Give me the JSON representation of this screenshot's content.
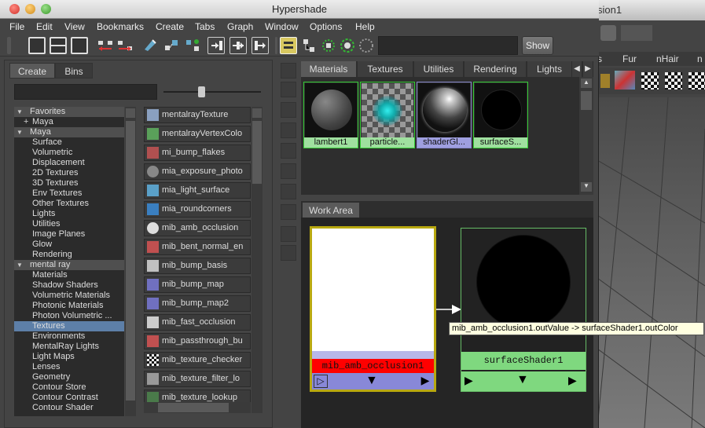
{
  "window": {
    "title": "Hypershade"
  },
  "background_app": {
    "title_fragment": "sion1",
    "shelf_tabs": [
      "s",
      "Fur",
      "nHair",
      "n"
    ]
  },
  "menu": [
    "File",
    "Edit",
    "View",
    "Bookmarks",
    "Create",
    "Tabs",
    "Graph",
    "Window",
    "Options",
    "Help"
  ],
  "toolbar": {
    "search_value": "",
    "show_label": "Show"
  },
  "left_tabs": [
    "Create",
    "Bins"
  ],
  "tree": [
    {
      "label": "Favorites",
      "type": "head",
      "prefix": "▼"
    },
    {
      "label": "Maya",
      "type": "child",
      "prefix": "+"
    },
    {
      "label": "Maya",
      "type": "head",
      "prefix": "▼"
    },
    {
      "label": "Surface",
      "type": "item"
    },
    {
      "label": "Volumetric",
      "type": "item"
    },
    {
      "label": "Displacement",
      "type": "item"
    },
    {
      "label": "2D Textures",
      "type": "item"
    },
    {
      "label": "3D Textures",
      "type": "item"
    },
    {
      "label": "Env Textures",
      "type": "item"
    },
    {
      "label": "Other Textures",
      "type": "item"
    },
    {
      "label": "Lights",
      "type": "item"
    },
    {
      "label": "Utilities",
      "type": "item"
    },
    {
      "label": "Image Planes",
      "type": "item"
    },
    {
      "label": "Glow",
      "type": "item"
    },
    {
      "label": "Rendering",
      "type": "item"
    },
    {
      "label": "mental ray",
      "type": "head",
      "prefix": "▼"
    },
    {
      "label": "Materials",
      "type": "item"
    },
    {
      "label": "Shadow Shaders",
      "type": "item"
    },
    {
      "label": "Volumetric Materials",
      "type": "item"
    },
    {
      "label": "Photonic Materials",
      "type": "item"
    },
    {
      "label": "Photon Volumetric ...",
      "type": "item"
    },
    {
      "label": "Textures",
      "type": "item",
      "selected": true
    },
    {
      "label": "Environments",
      "type": "item"
    },
    {
      "label": "MentalRay Lights",
      "type": "item"
    },
    {
      "label": "Light Maps",
      "type": "item"
    },
    {
      "label": "Lenses",
      "type": "item"
    },
    {
      "label": "Geometry",
      "type": "item"
    },
    {
      "label": "Contour Store",
      "type": "item"
    },
    {
      "label": "Contour Contrast",
      "type": "item"
    },
    {
      "label": "Contour Shader",
      "type": "item"
    }
  ],
  "node_list": [
    {
      "label": "mentalrayTexture",
      "icon": "texture-icon",
      "color": "#8aa0c0"
    },
    {
      "label": "mentalrayVertexColo",
      "icon": "vertex-color-icon",
      "color": "#5aa05a"
    },
    {
      "label": "mi_bump_flakes",
      "icon": "bump-flakes-icon",
      "color": "#b05050"
    },
    {
      "label": "mia_exposure_photo",
      "icon": "exposure-icon",
      "color": "#888888"
    },
    {
      "label": "mia_light_surface",
      "icon": "light-surface-icon",
      "color": "#5aa0c8"
    },
    {
      "label": "mia_roundcorners",
      "icon": "roundcorners-icon",
      "color": "#3a7fc0"
    },
    {
      "label": "mib_amb_occlusion",
      "icon": "amb-occlusion-icon",
      "color": "#dddddd"
    },
    {
      "label": "mib_bent_normal_en",
      "icon": "bent-normal-icon",
      "color": "#c05050"
    },
    {
      "label": "mib_bump_basis",
      "icon": "bump-basis-icon",
      "color": "#c0c0c0"
    },
    {
      "label": "mib_bump_map",
      "icon": "bump-map-icon",
      "color": "#7070c0"
    },
    {
      "label": "mib_bump_map2",
      "icon": "bump-map2-icon",
      "color": "#7070c0"
    },
    {
      "label": "mib_fast_occlusion",
      "icon": "fast-occlusion-icon",
      "color": "#cccccc"
    },
    {
      "label": "mib_passthrough_bu",
      "icon": "passthrough-icon",
      "color": "#c05050"
    },
    {
      "label": "mib_texture_checker",
      "icon": "checker-icon",
      "color": "#dddddd"
    },
    {
      "label": "mib_texture_filter_lo",
      "icon": "filter-icon",
      "color": "#999999"
    },
    {
      "label": "mib_texture_lookup",
      "icon": "lookup-icon",
      "color": "#4a7a4a"
    }
  ],
  "material_tabs": [
    "Materials",
    "Textures",
    "Utilities",
    "Rendering",
    "Lights"
  ],
  "swatches": [
    {
      "label": "lambert1",
      "kind": "lambert",
      "caption_color": "#9fe09f"
    },
    {
      "label": "particle...",
      "kind": "particle",
      "caption_color": "#9fe09f"
    },
    {
      "label": "shaderGl...",
      "kind": "glow",
      "caption_color": "#9f9fe0"
    },
    {
      "label": "surfaceS...",
      "kind": "surface",
      "caption_color": "#9fe09f"
    }
  ],
  "work_area": {
    "tab_label": "Work Area",
    "node1": {
      "label": "mib_amb_occlusion1",
      "label_color": "#ff0000",
      "border_color": "#b8a810"
    },
    "node2": {
      "label": "surfaceShader1",
      "label_color": "#7fd87f",
      "border_color": "#66bb66"
    },
    "tooltip": "mib_amb_occlusion1.outValue -> surfaceShader1.outColor"
  }
}
